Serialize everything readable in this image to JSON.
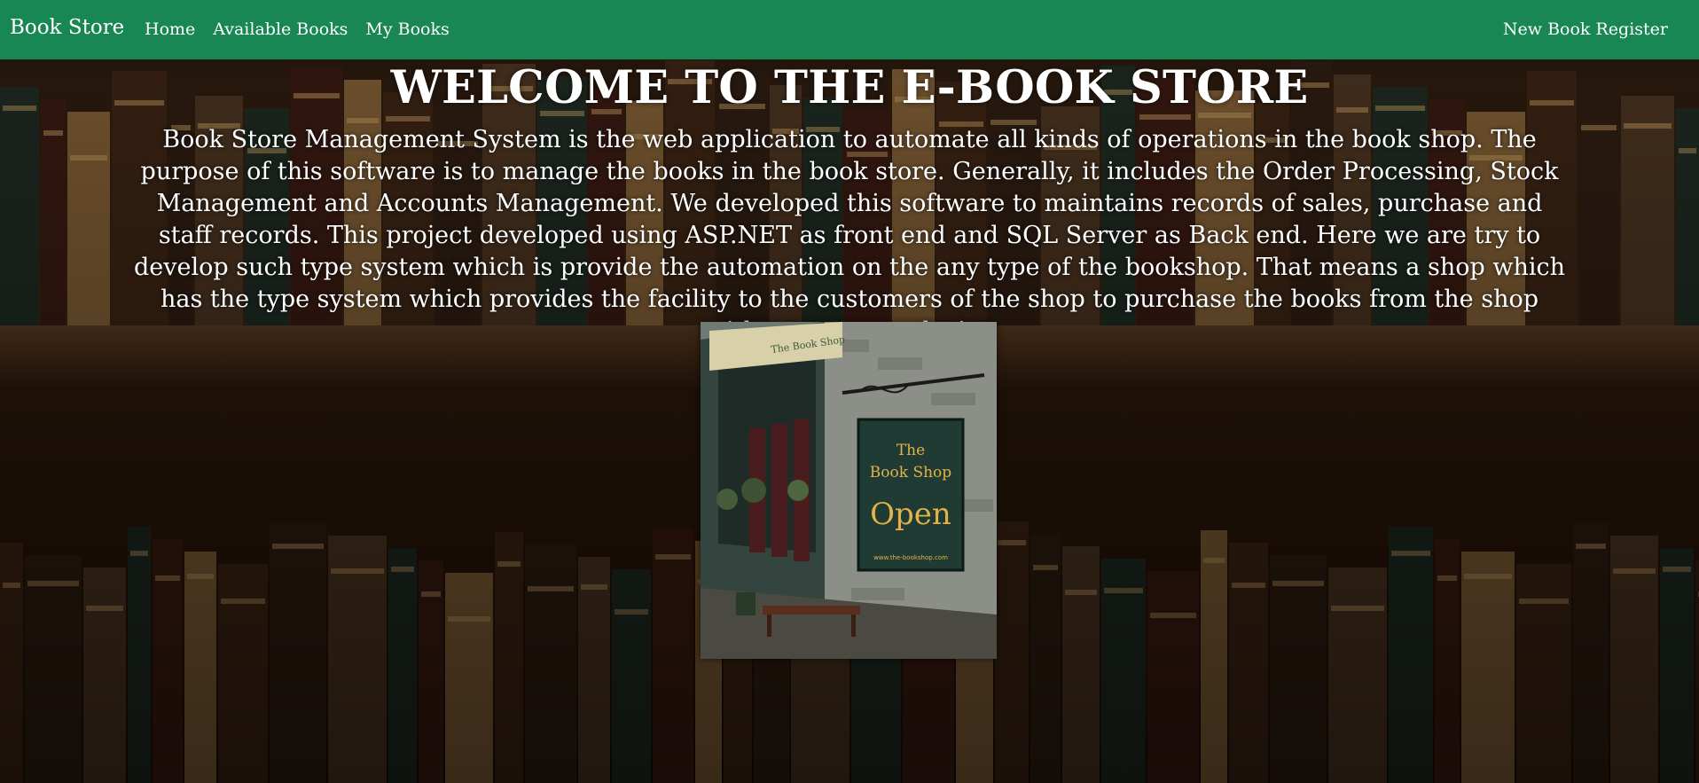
{
  "navbar": {
    "brand": "Book Store",
    "links": [
      "Home",
      "Available Books",
      "My Books"
    ],
    "right_link": "New Book Register",
    "color": "#198754"
  },
  "main": {
    "title": "WELCOME TO THE E-BOOK STORE",
    "description": "Book Store Management System is the web application to automate all kinds of operations in the book shop. The purpose of this software is to manage the books in the book store. Generally, it includes the Order Processing, Stock Management and Accounts Management. We developed this software to maintains records of sales, purchase and staff records. This project developed using ASP.NET as front end and SQL Server as Back end. Here we are try to develop such type system which is provide the automation on the any type of the bookshop. That means a shop which has the type system which provides the facility to the customers of the shop to purchase the books from the shop without any complexity."
  },
  "shop_image": {
    "sign_line1": "The",
    "sign_line2": "Book Shop",
    "sign_line3": "Open",
    "sign_url": "www.the-bookshop.com"
  }
}
